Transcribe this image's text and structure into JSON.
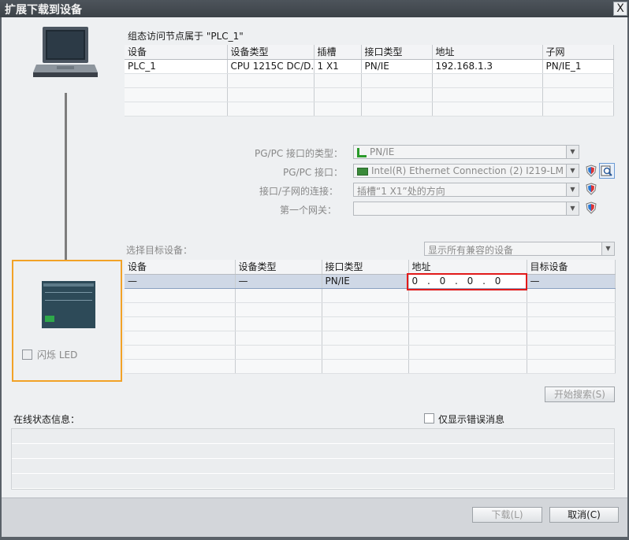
{
  "window": {
    "title": "扩展下载到设备",
    "close": "X"
  },
  "config_section": {
    "heading": "组态访问节点属于 \"PLC_1\"",
    "columns": [
      "设备",
      "设备类型",
      "插槽",
      "接口类型",
      "地址",
      "子网"
    ],
    "rows": [
      [
        "PLC_1",
        "CPU 1215C DC/D...",
        "1 X1",
        "PN/IE",
        "192.168.1.3",
        "PN/IE_1"
      ]
    ]
  },
  "interface": {
    "type_label": "PG/PC 接口的类型：",
    "type_value": "PN/IE",
    "iface_label": "PG/PC 接口：",
    "iface_value": "Intel(R) Ethernet Connection (2) I219-LM",
    "conn_label": "接口/子网的连接：",
    "conn_value": "插槽“1 X1”处的方向",
    "gateway_label": "第一个网关：",
    "gateway_value": ""
  },
  "target_section": {
    "label": "选择目标设备：",
    "filter_value": "显示所有兼容的设备",
    "columns": [
      "设备",
      "设备类型",
      "接口类型",
      "地址",
      "目标设备"
    ],
    "rows": [
      [
        "—",
        "—",
        "PN/IE",
        "0 . 0 . 0 . 0",
        "—"
      ]
    ],
    "ip_octets": [
      "0",
      "0",
      "0",
      "0"
    ]
  },
  "flash_led": {
    "label": "闪烁 LED"
  },
  "search_button": "开始搜索(S)",
  "status": {
    "label": "在线状态信息：",
    "errors_only_label": "仅显示错误消息"
  },
  "footer": {
    "download_button": "下载(L)",
    "cancel_button": "取消(C)"
  },
  "colors": {
    "highlight_box": "#f2a227",
    "address_box": "#e21a1a",
    "selected_row": "#cfd8e6"
  }
}
